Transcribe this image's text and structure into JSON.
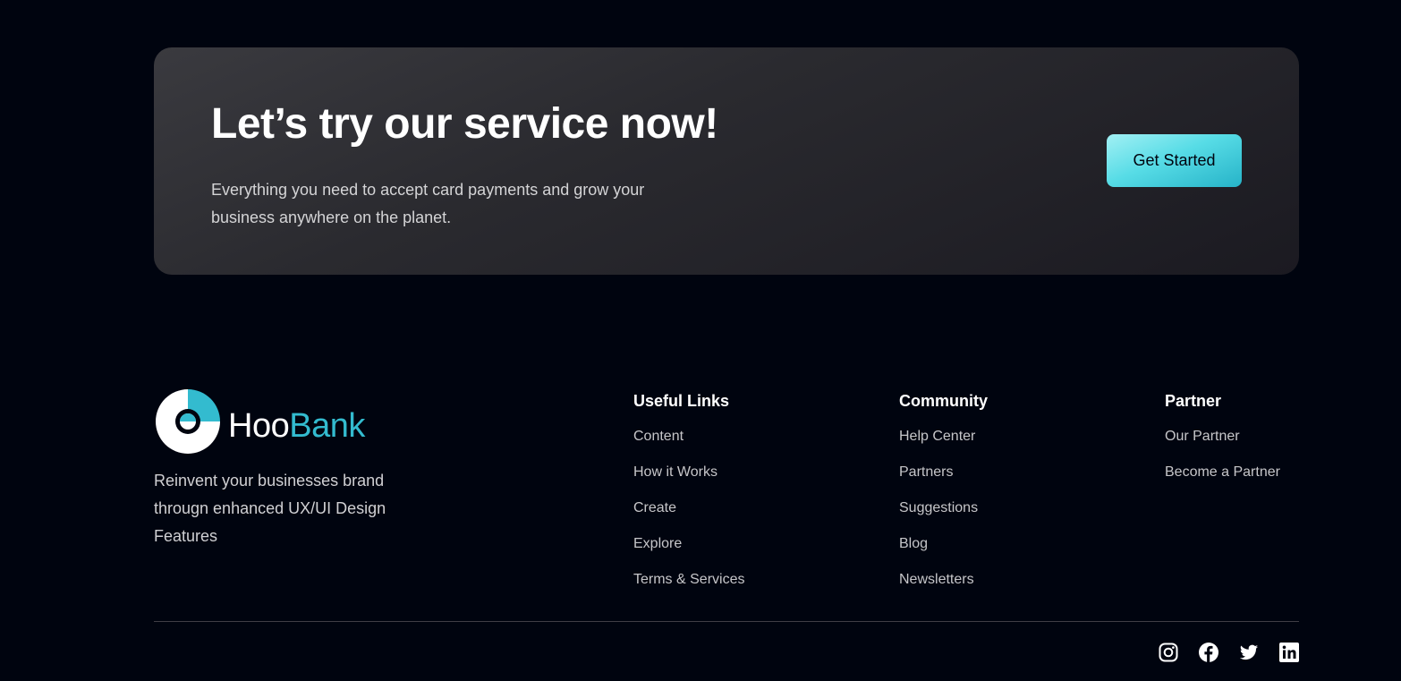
{
  "cta": {
    "title": "Let’s try our service now!",
    "subtitle": "Everything you need to accept card payments and grow your business anywhere on the planet.",
    "button_label": "Get Started"
  },
  "brand": {
    "name_part1": "Hoo",
    "name_part2": "Bank",
    "tagline": "Reinvent your businesses brand througn enhanced UX/UI Design Features",
    "accent_color": "#33bbcf"
  },
  "footer": {
    "columns": [
      {
        "title": "Useful Links",
        "links": [
          "Content",
          "How it Works",
          "Create",
          "Explore",
          "Terms & Services"
        ]
      },
      {
        "title": "Community",
        "links": [
          "Help Center",
          "Partners",
          "Suggestions",
          "Blog",
          "Newsletters"
        ]
      },
      {
        "title": "Partner",
        "links": [
          "Our Partner",
          "Become a Partner"
        ]
      }
    ],
    "socials": [
      "instagram-icon",
      "facebook-icon",
      "twitter-icon",
      "linkedin-icon"
    ]
  },
  "colors": {
    "background": "#00040f",
    "button_gradient_start": "#a2f0f4",
    "button_gradient_end": "#26b3c8"
  }
}
